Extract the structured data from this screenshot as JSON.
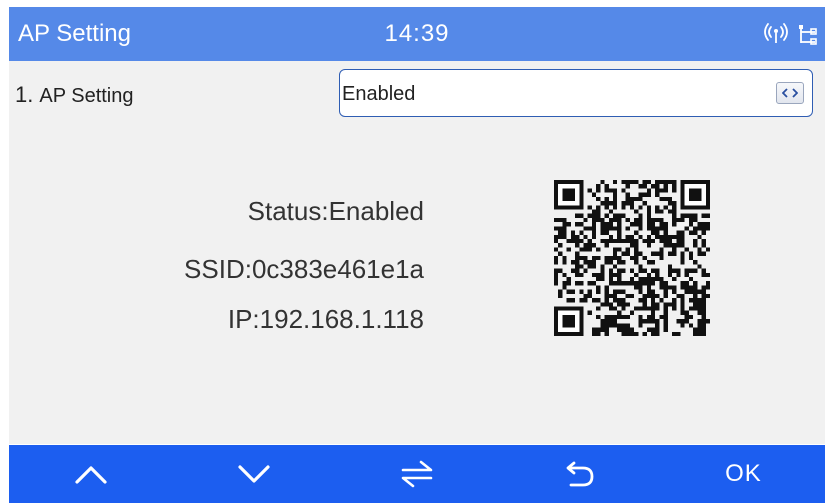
{
  "header": {
    "title": "AP Setting",
    "time": "14:39",
    "icons": [
      "antenna-signal-icon",
      "ethernet-network-icon"
    ]
  },
  "setting": {
    "number": "1.",
    "label": "AP Setting",
    "value": "Enabled",
    "toggle_icon": "left-right-toggle-icon"
  },
  "info": {
    "status": "Status:Enabled",
    "ssid": "SSID:0c383e461e1a",
    "ip": "IP:192.168.1.118"
  },
  "qr_icon": "qr-code",
  "footer": {
    "buttons": [
      {
        "icon": "chevron-up-icon"
      },
      {
        "icon": "chevron-down-icon"
      },
      {
        "icon": "switch-arrows-icon"
      },
      {
        "icon": "back-icon"
      },
      {
        "label": "OK"
      }
    ]
  },
  "colors": {
    "header_bg": "#5589e8",
    "content_bg": "#f1f1f1",
    "footer_bg": "#1c5ef0",
    "select_border": "#2f5db3"
  }
}
